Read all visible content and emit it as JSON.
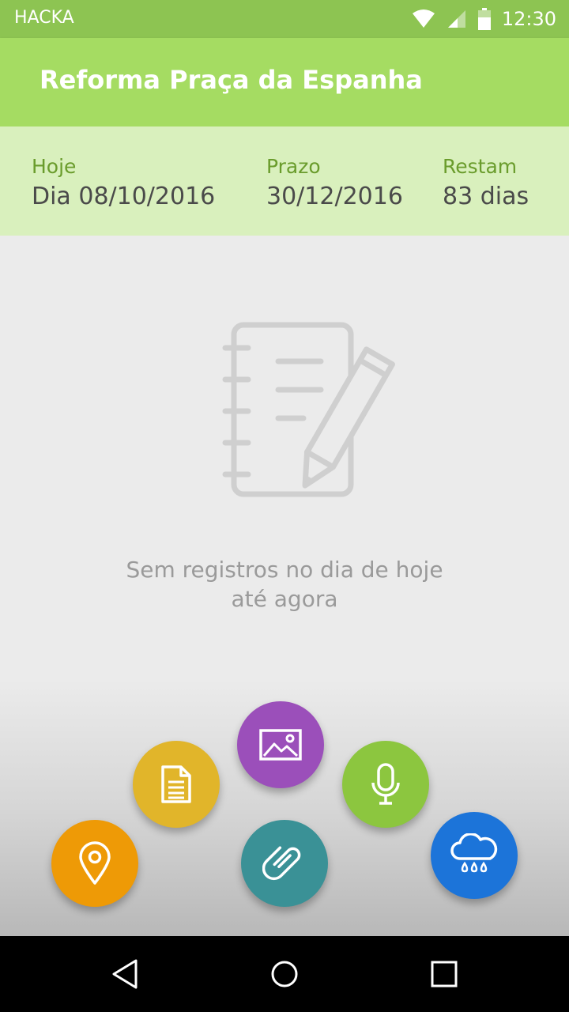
{
  "status_bar": {
    "carrier": "HACKA",
    "time": "12:30",
    "icons": [
      "wifi-icon",
      "signal-icon",
      "battery-icon"
    ]
  },
  "app_bar": {
    "title": "Reforma Praça da Espanha"
  },
  "info_bar": {
    "today_label": "Hoje",
    "today_value": "Dia 08/10/2016",
    "deadline_label": "Prazo",
    "deadline_value": "30/12/2016",
    "remaining_label": "Restam",
    "remaining_value": "83 dias"
  },
  "empty_state": {
    "icon": "notebook-pencil-icon",
    "message": "Sem registros no dia de hoje até agora"
  },
  "fab_menu": [
    {
      "name": "location",
      "icon": "map-pin-icon",
      "color": "#ee9a06"
    },
    {
      "name": "document",
      "icon": "document-icon",
      "color": "#e1b52a"
    },
    {
      "name": "image",
      "icon": "image-icon",
      "color": "#9b4fba"
    },
    {
      "name": "attachment",
      "icon": "paperclip-icon",
      "color": "#3a9196"
    },
    {
      "name": "audio",
      "icon": "microphone-icon",
      "color": "#8cc63f"
    },
    {
      "name": "weather",
      "icon": "rain-cloud-icon",
      "color": "#1c74d9"
    }
  ],
  "colors": {
    "status_bar": "#8dc452",
    "app_bar": "#a5dc62",
    "info_bar": "#d9f0bd",
    "background": "#ebebeb"
  },
  "nav_bar": {
    "icons": [
      "back-icon",
      "home-icon",
      "recents-icon"
    ]
  }
}
